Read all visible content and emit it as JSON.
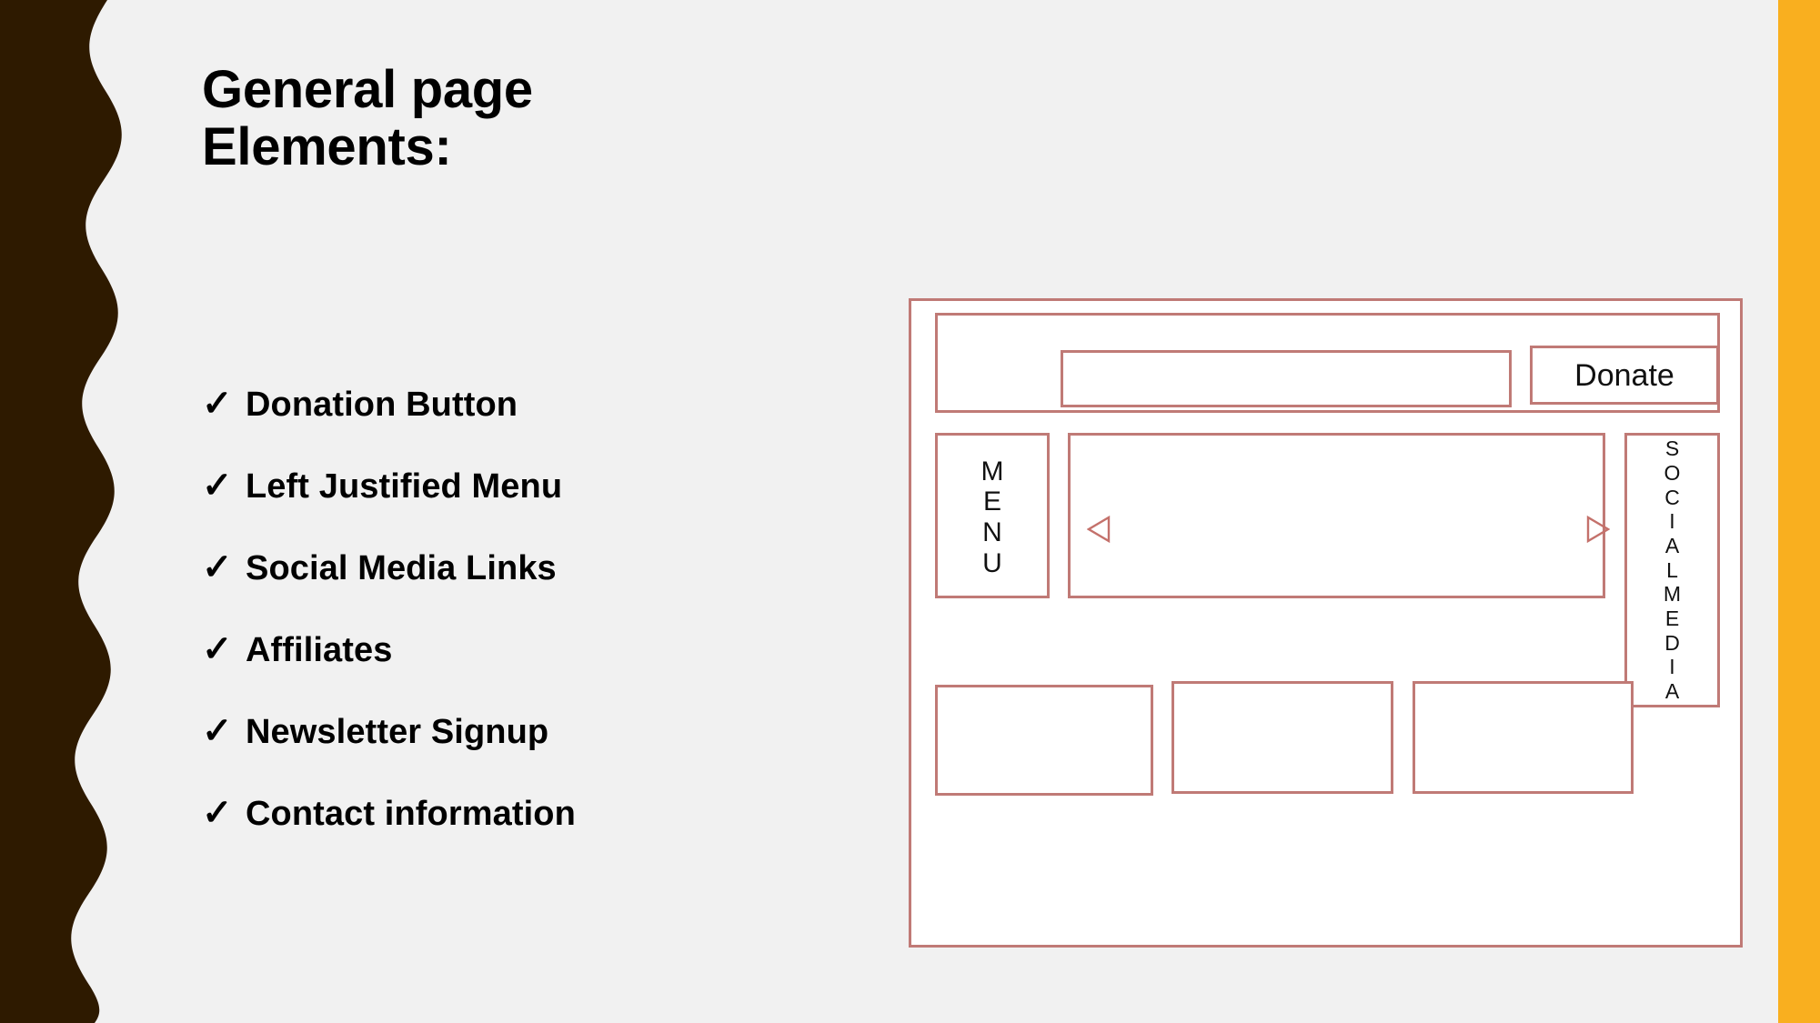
{
  "slide": {
    "title_lines": [
      "General page",
      "Elements:"
    ],
    "background_color": "#F1F1F1",
    "accent_left_color": "#2E1A00",
    "accent_right_color": "#F9AF1F",
    "wireframe_stroke_color": "#C07A76"
  },
  "bullets": {
    "marker": "✓",
    "items": [
      {
        "label": "Donation Button"
      },
      {
        "label": "Left Justified Menu"
      },
      {
        "label": "Social Media Links"
      },
      {
        "label": "Affiliates"
      },
      {
        "label": "Newsletter Signup"
      },
      {
        "label": "Contact information"
      }
    ]
  },
  "wireframe": {
    "donate_button_label": "Donate",
    "menu_label_letters": [
      "M",
      "E",
      "N",
      "U"
    ],
    "social_label_letters": [
      "S",
      "O",
      "C",
      "I",
      "A",
      "L",
      "M",
      "E",
      "D",
      "I",
      "A"
    ],
    "prev_arrow_icon": "triangle-left-icon",
    "next_arrow_icon": "triangle-right-icon",
    "logo_search_bar": "",
    "footer_boxes": [
      "",
      "",
      ""
    ]
  }
}
